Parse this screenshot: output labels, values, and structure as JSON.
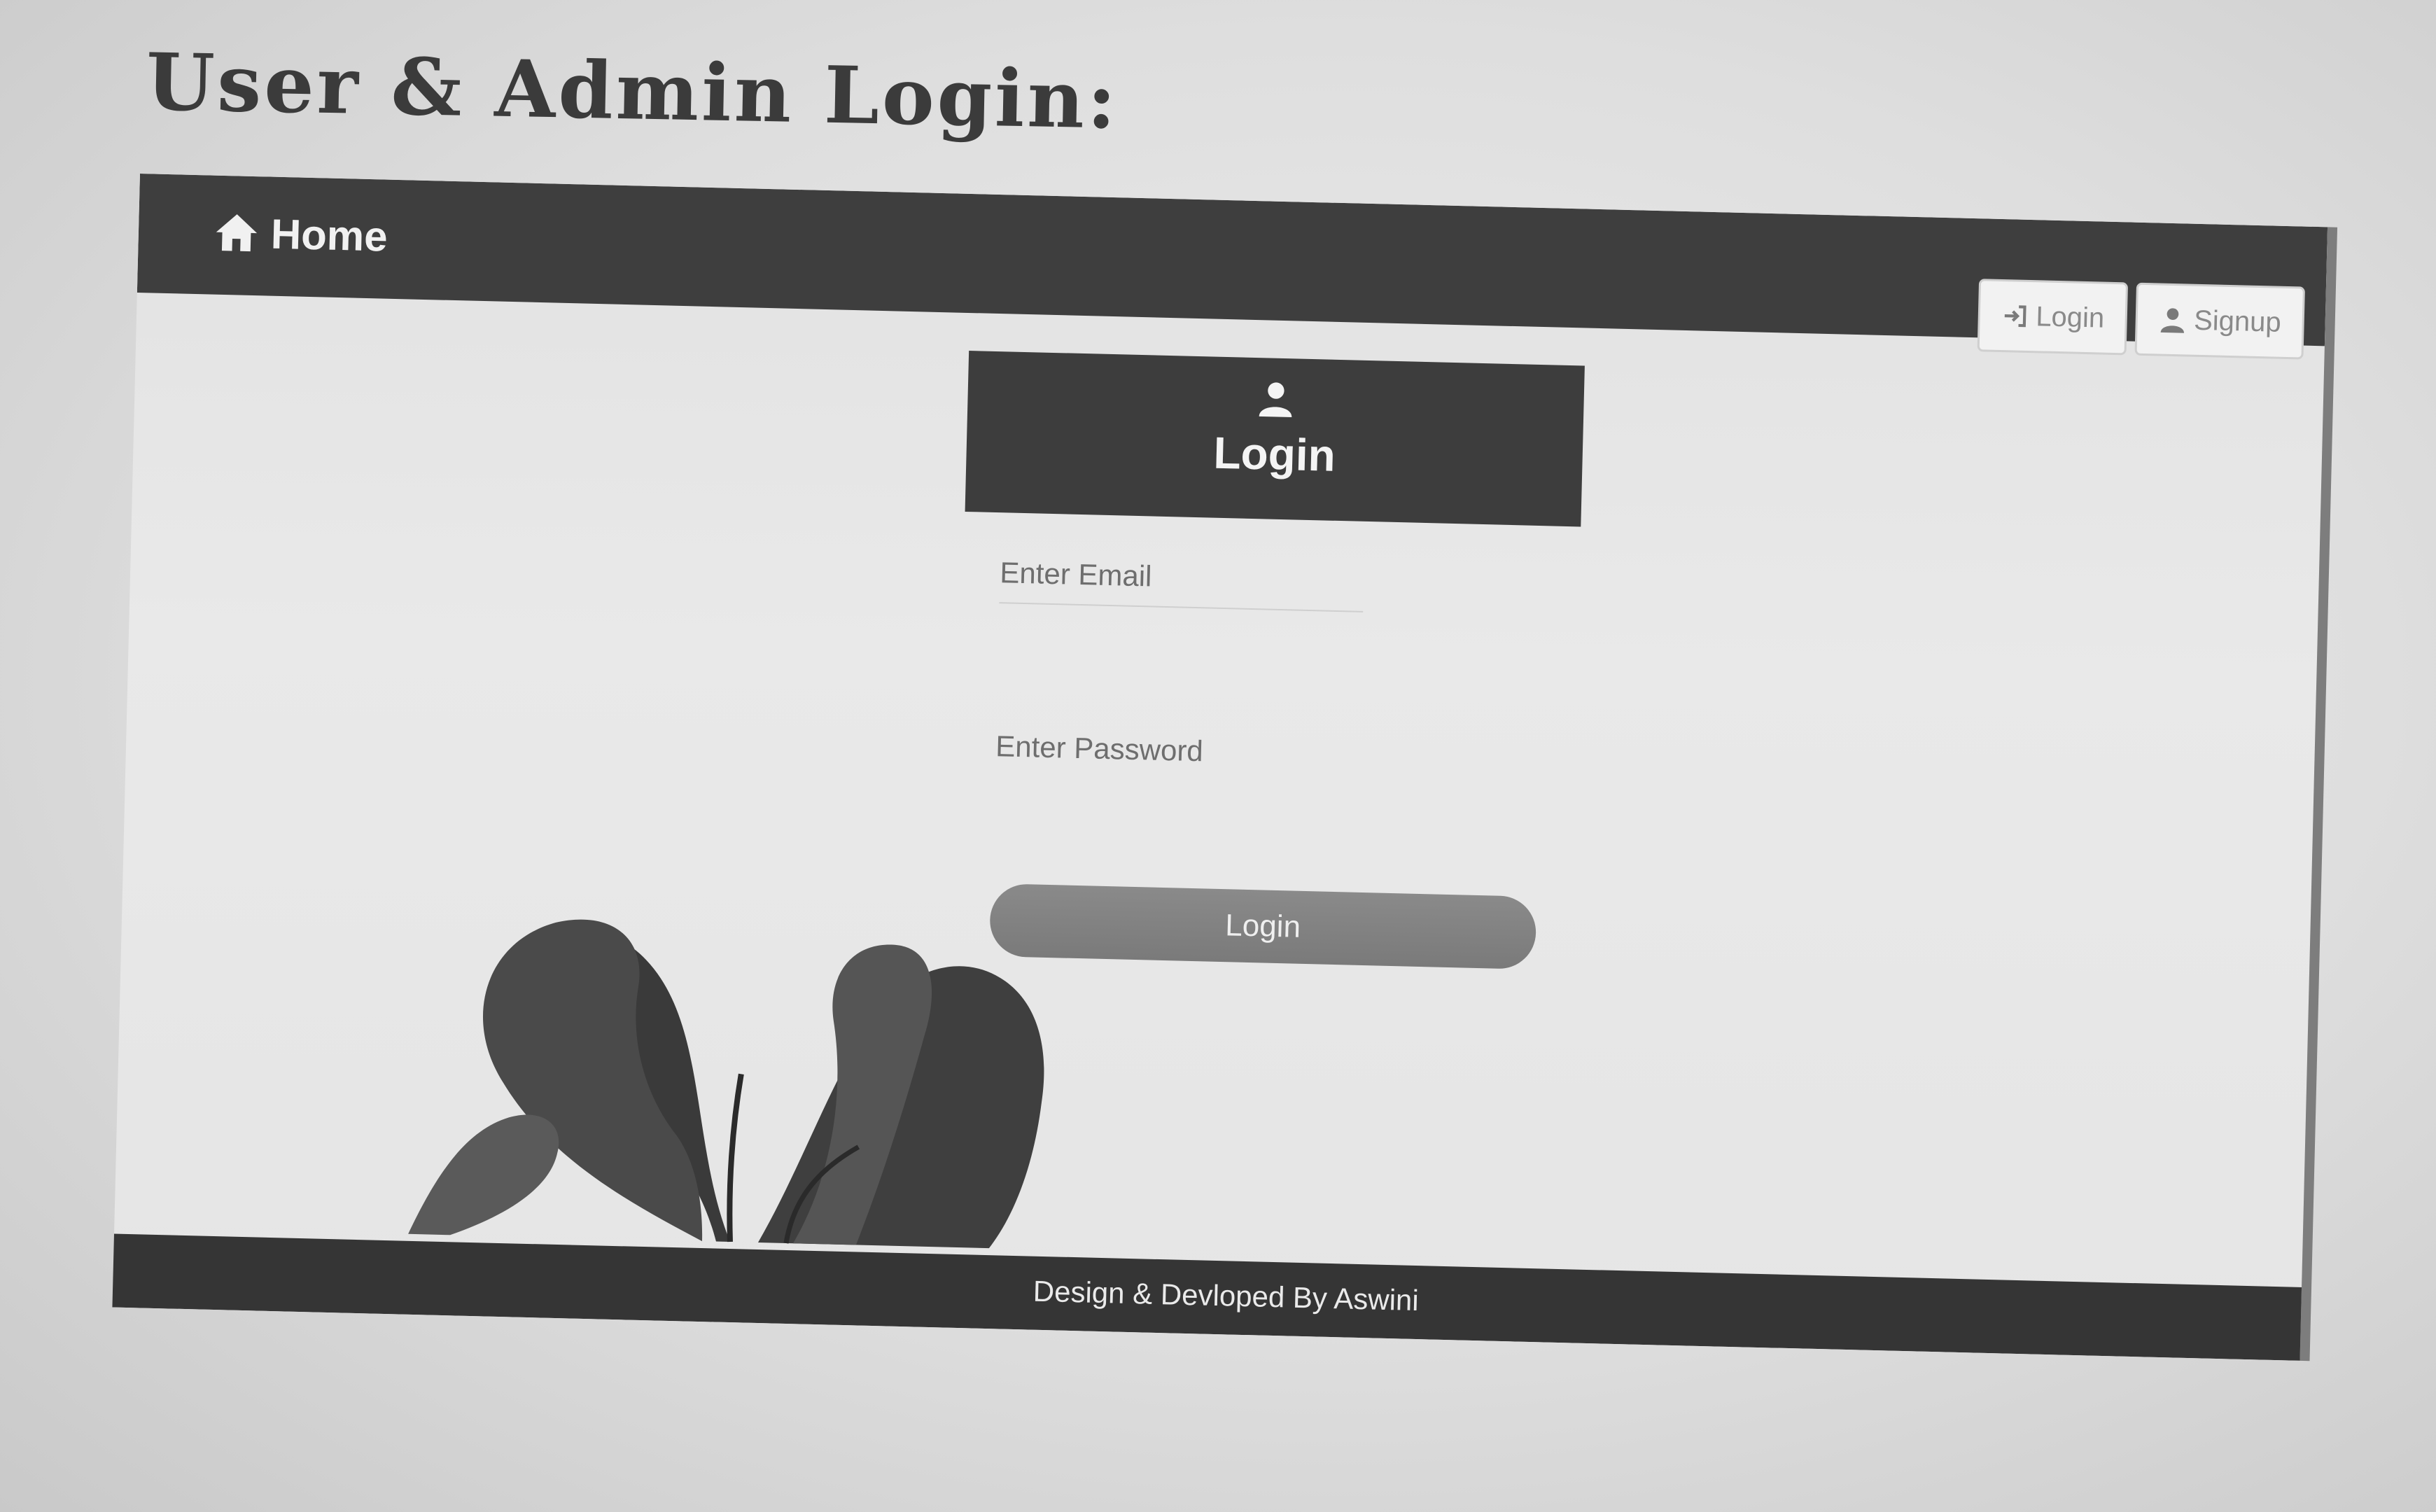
{
  "document": {
    "heading": "User & Admin Login:"
  },
  "navbar": {
    "home_label": "Home",
    "login_label": "Login",
    "signup_label": "Signup"
  },
  "login_card": {
    "title": "Login",
    "email_placeholder": "Enter Email",
    "password_placeholder": "Enter Password",
    "submit_label": "Login"
  },
  "footer": {
    "text": "Design & Devloped By Aswini"
  },
  "icons": {
    "home": "home-icon",
    "login": "sign-in-icon",
    "signup": "user-icon",
    "card_header": "user-icon"
  },
  "colors": {
    "navbar": "#3e3e3e",
    "card_header": "#3d3d3d",
    "button": "#7f7f7f",
    "footer": "#353535"
  }
}
